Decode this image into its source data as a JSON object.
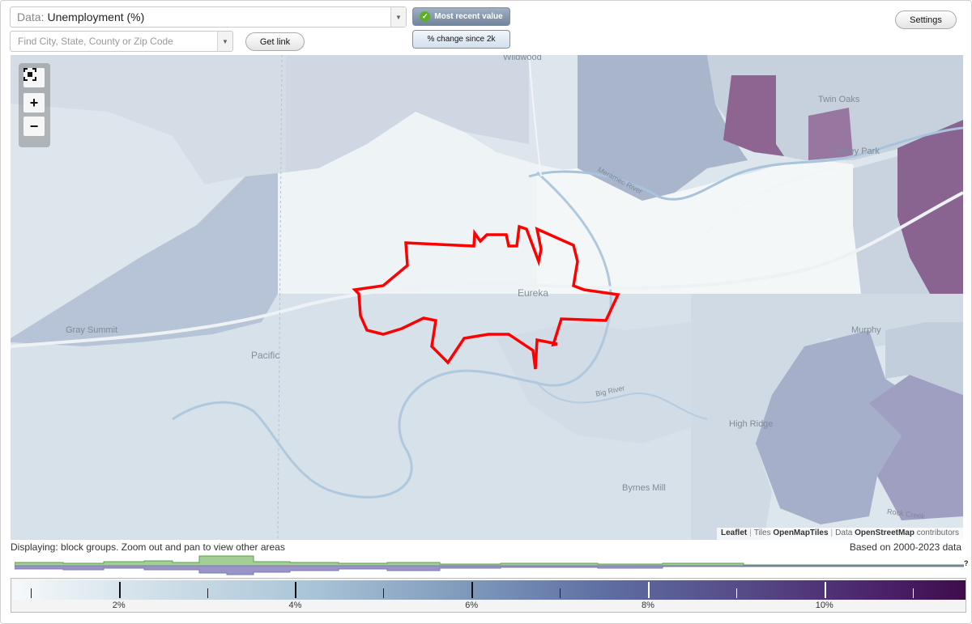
{
  "controls": {
    "data_prefix": "Data:",
    "data_value": "Unemployment (%)",
    "search_placeholder": "Find City, State, County or Zip Code",
    "get_link_label": "Get link",
    "toggle_most_recent": "Most recent value",
    "toggle_change": "% change since 2k",
    "settings_label": "Settings"
  },
  "map": {
    "place_labels": {
      "wildwood": "Wildwood",
      "twin_oaks": "Twin Oaks",
      "valley_park": "Valley Park",
      "eureka": "Eureka",
      "gray_summit": "Gray Summit",
      "pacific": "Pacific",
      "murphy": "Murphy",
      "high_ridge": "High Ridge",
      "byrnes_mill": "Byrnes Mill",
      "big_river": "Big River",
      "meramec_river": "Meramec River",
      "rock_creek": "Rock Creek"
    },
    "attribution": {
      "leaflet": "Leaflet",
      "tiles_prefix": "Tiles",
      "tiles": "OpenMapTiles",
      "data_prefix": "Data",
      "data": "OpenStreetMap",
      "suffix": "contributors"
    },
    "colors": {
      "boundary": "#ff0000",
      "high_value": "#7b3f75"
    }
  },
  "footer": {
    "displaying": "Displaying: block groups. Zoom out and pan to view other areas",
    "based_on": "Based on 2000-2023 data",
    "help_mark": "?"
  },
  "legend": {
    "range_min": 0.8,
    "range_max": 11.6,
    "labels": [
      "2%",
      "4%",
      "6%",
      "8%",
      "10%"
    ],
    "major_ticks": [
      2,
      4,
      6,
      8,
      10
    ],
    "minor_ticks": [
      1,
      3,
      5,
      7,
      9,
      11
    ]
  }
}
